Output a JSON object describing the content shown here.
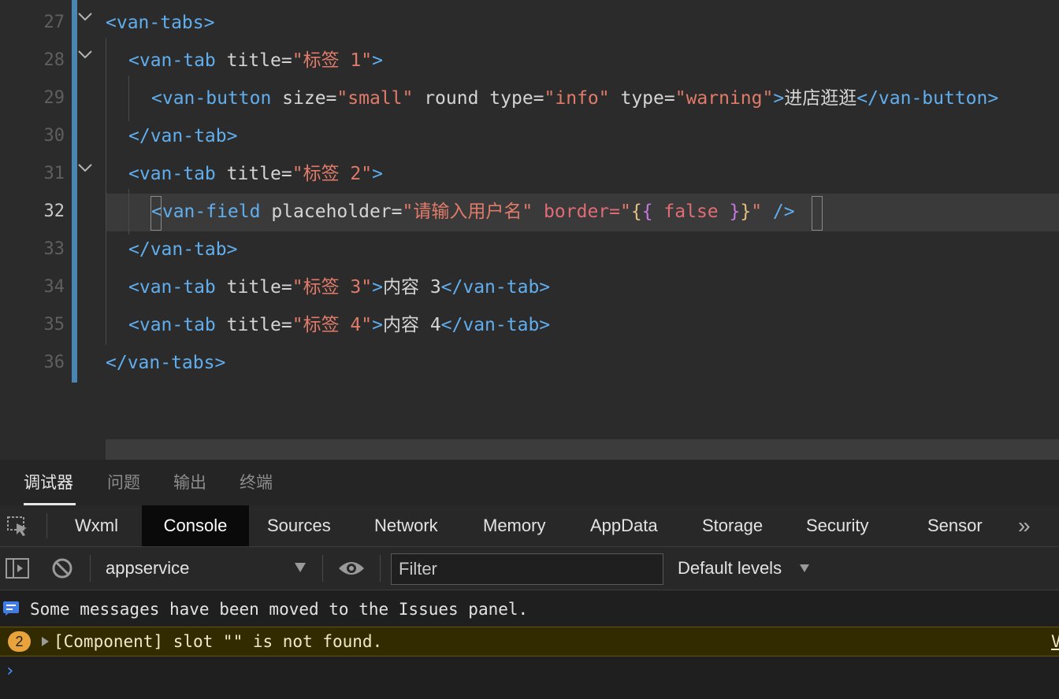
{
  "editor": {
    "lines": [
      {
        "num": "27",
        "segments": [
          [
            "t-tag",
            "<van-tabs>"
          ]
        ]
      },
      {
        "num": "28",
        "segments": [
          [
            "t-tag",
            "<van-tab "
          ],
          [
            "t-attr",
            "title="
          ],
          [
            "t-str",
            "\"标签 1\""
          ],
          [
            "t-tag",
            ">"
          ]
        ]
      },
      {
        "num": "29",
        "segments": [
          [
            "t-tag",
            "<van-button "
          ],
          [
            "t-attr",
            "size="
          ],
          [
            "t-str",
            "\"small\""
          ],
          [
            "t-attr",
            " round type="
          ],
          [
            "t-str",
            "\"info\""
          ],
          [
            "t-attr",
            " type="
          ],
          [
            "t-str",
            "\"warning\""
          ],
          [
            "t-tag",
            ">"
          ],
          [
            "t-text",
            "进店逛逛"
          ],
          [
            "t-tag",
            "</van-button>"
          ]
        ]
      },
      {
        "num": "30",
        "segments": [
          [
            "t-tag",
            "</van-tab>"
          ]
        ]
      },
      {
        "num": "31",
        "segments": [
          [
            "t-tag",
            "<van-tab "
          ],
          [
            "t-attr",
            "title="
          ],
          [
            "t-str",
            "\"标签 2\""
          ],
          [
            "t-tag",
            ">"
          ]
        ]
      },
      {
        "num": "32",
        "segments": [
          [
            "t-tag",
            "<van-field "
          ],
          [
            "t-attr",
            "placeholder="
          ],
          [
            "t-str",
            "\"请输入用户名\""
          ],
          [
            "t-red",
            " border="
          ],
          [
            "t-str",
            "\""
          ],
          [
            "t-brace",
            "{"
          ],
          [
            "t-brace2",
            "{"
          ],
          [
            "t-red",
            " false "
          ],
          [
            "t-brace2",
            "}"
          ],
          [
            "t-brace",
            "}"
          ],
          [
            "t-str",
            "\""
          ],
          [
            "t-tag",
            " />"
          ]
        ]
      },
      {
        "num": "33",
        "segments": [
          [
            "t-tag",
            "</van-tab>"
          ]
        ]
      },
      {
        "num": "34",
        "segments": [
          [
            "t-tag",
            "<van-tab "
          ],
          [
            "t-attr",
            "title="
          ],
          [
            "t-str",
            "\"标签 3\""
          ],
          [
            "t-tag",
            ">"
          ],
          [
            "t-text",
            "内容 3"
          ],
          [
            "t-tag",
            "</van-tab>"
          ]
        ]
      },
      {
        "num": "35",
        "segments": [
          [
            "t-tag",
            "<van-tab "
          ],
          [
            "t-attr",
            "title="
          ],
          [
            "t-str",
            "\"标签 4\""
          ],
          [
            "t-tag",
            ">"
          ],
          [
            "t-text",
            "内容 4"
          ],
          [
            "t-tag",
            "</van-tab>"
          ]
        ]
      },
      {
        "num": "36",
        "segments": [
          [
            "t-tag",
            "</van-tabs>"
          ]
        ]
      }
    ],
    "active_line": "32"
  },
  "panel_tabs": [
    "调试器",
    "问题",
    "输出",
    "终端"
  ],
  "devtools": {
    "tabs": [
      "Wxml",
      "Console",
      "Sources",
      "Network",
      "Memory",
      "AppData",
      "Storage",
      "Security",
      "Sensor"
    ],
    "active_tab": "Console",
    "more_icon": "»",
    "context": "appservice",
    "filter_placeholder": "Filter",
    "levels": "Default levels"
  },
  "console": {
    "info_message": "Some messages have been moved to the Issues panel.",
    "warning_count": "2",
    "warning_message": "[Component] slot \"\" is not found.",
    "warning_link": "V",
    "prompt": "›"
  },
  "colors": {
    "accent_bar": "#4a86b2",
    "tag": "#61aeee",
    "string": "#e07b6a",
    "warning_bg": "#332b00",
    "warning_badge": "#e8a33d",
    "prompt": "#4f8ff7"
  }
}
